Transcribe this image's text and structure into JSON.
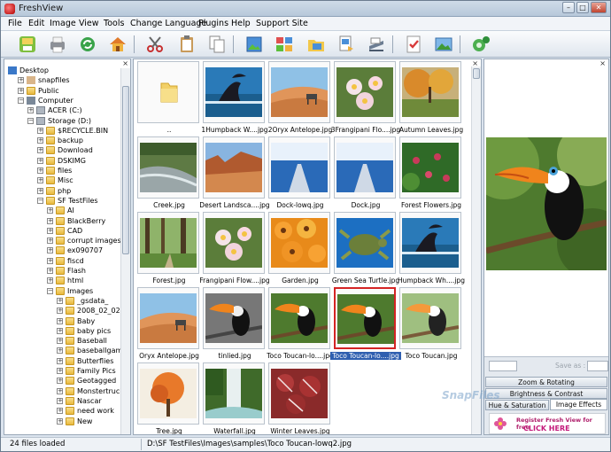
{
  "window": {
    "title": "FreshView"
  },
  "menu": [
    "File",
    "Edit",
    "Image",
    "View",
    "Tools",
    "Change Language",
    "Plugins",
    "Help",
    "Support Site"
  ],
  "tree": {
    "rows": [
      {
        "label": "Desktop",
        "depth": 0,
        "exp": "",
        "icon": "desktop"
      },
      {
        "label": "snapfiles",
        "depth": 1,
        "exp": "+",
        "icon": "user"
      },
      {
        "label": "Public",
        "depth": 1,
        "exp": "+",
        "icon": "folder"
      },
      {
        "label": "Computer",
        "depth": 1,
        "exp": "-",
        "icon": "computer"
      },
      {
        "label": "ACER (C:)",
        "depth": 2,
        "exp": "+",
        "icon": "drive"
      },
      {
        "label": "Storage (D:)",
        "depth": 2,
        "exp": "-",
        "icon": "drive"
      },
      {
        "label": "$RECYCLE.BIN",
        "depth": 3,
        "exp": "+",
        "icon": "folder"
      },
      {
        "label": "backup",
        "depth": 3,
        "exp": "+",
        "icon": "folder"
      },
      {
        "label": "Download",
        "depth": 3,
        "exp": "+",
        "icon": "folder"
      },
      {
        "label": "DSKIMG",
        "depth": 3,
        "exp": "+",
        "icon": "folder"
      },
      {
        "label": "files",
        "depth": 3,
        "exp": "+",
        "icon": "folder"
      },
      {
        "label": "Misc",
        "depth": 3,
        "exp": "+",
        "icon": "folder"
      },
      {
        "label": "php",
        "depth": 3,
        "exp": "+",
        "icon": "folder"
      },
      {
        "label": "SF TestFiles",
        "depth": 3,
        "exp": "-",
        "icon": "folder"
      },
      {
        "label": "AI",
        "depth": 4,
        "exp": "+",
        "icon": "folder"
      },
      {
        "label": "BlackBerry",
        "depth": 4,
        "exp": "+",
        "icon": "folder"
      },
      {
        "label": "CAD",
        "depth": 4,
        "exp": "+",
        "icon": "folder"
      },
      {
        "label": "corrupt images",
        "depth": 4,
        "exp": "+",
        "icon": "folder"
      },
      {
        "label": "ex090707",
        "depth": 4,
        "exp": "+",
        "icon": "folder"
      },
      {
        "label": "fiscd",
        "depth": 4,
        "exp": "+",
        "icon": "folder"
      },
      {
        "label": "Flash",
        "depth": 4,
        "exp": "+",
        "icon": "folder"
      },
      {
        "label": "html",
        "depth": 4,
        "exp": "+",
        "icon": "folder"
      },
      {
        "label": "Images",
        "depth": 4,
        "exp": "-",
        "icon": "folder"
      },
      {
        "label": "_gsdata_",
        "depth": 5,
        "exp": "+",
        "icon": "folder"
      },
      {
        "label": "2008_02_02",
        "depth": 5,
        "exp": "+",
        "icon": "folder"
      },
      {
        "label": "Baby",
        "depth": 5,
        "exp": "+",
        "icon": "folder"
      },
      {
        "label": "baby pics",
        "depth": 5,
        "exp": "+",
        "icon": "folder"
      },
      {
        "label": "Baseball",
        "depth": 5,
        "exp": "+",
        "icon": "folder"
      },
      {
        "label": "baseballgame",
        "depth": 5,
        "exp": "+",
        "icon": "folder"
      },
      {
        "label": "Butterflies",
        "depth": 5,
        "exp": "+",
        "icon": "folder"
      },
      {
        "label": "Family Pics",
        "depth": 5,
        "exp": "+",
        "icon": "folder"
      },
      {
        "label": "Geotagged",
        "depth": 5,
        "exp": "+",
        "icon": "folder"
      },
      {
        "label": "Monstertruck",
        "depth": 5,
        "exp": "+",
        "icon": "folder"
      },
      {
        "label": "Nascar",
        "depth": 5,
        "exp": "+",
        "icon": "folder"
      },
      {
        "label": "need work",
        "depth": 5,
        "exp": "+",
        "icon": "folder"
      },
      {
        "label": "New",
        "depth": 5,
        "exp": "+",
        "icon": "folder"
      }
    ]
  },
  "thumbnails": [
    {
      "caption": "..",
      "kind": "folder"
    },
    {
      "caption": "1Humpback W....jpg",
      "kind": "whale"
    },
    {
      "caption": "2Oryx Antelope.jpg",
      "kind": "desert"
    },
    {
      "caption": "3Frangipani Flo....jpg",
      "kind": "flower"
    },
    {
      "caption": "Autumn Leaves.jpg",
      "kind": "autumn"
    },
    {
      "caption": "Creek.jpg",
      "kind": "creek"
    },
    {
      "caption": "Desert Landsca....jpg",
      "kind": "canyon"
    },
    {
      "caption": "Dock-lowq.jpg",
      "kind": "dock"
    },
    {
      "caption": "Dock.jpg",
      "kind": "dock"
    },
    {
      "caption": "Forest Flowers.jpg",
      "kind": "forest-flowers"
    },
    {
      "caption": "Forest.jpg",
      "kind": "forest"
    },
    {
      "caption": "Frangipani Flow....jpg",
      "kind": "flower"
    },
    {
      "caption": "Garden.jpg",
      "kind": "garden"
    },
    {
      "caption": "Green Sea Turtle.jpg",
      "kind": "turtle"
    },
    {
      "caption": "Humpback Wh....jpg",
      "kind": "whale"
    },
    {
      "caption": "Oryx Antelope.jpg",
      "kind": "desert"
    },
    {
      "caption": "tinlied.jpg",
      "kind": "toucan-gray"
    },
    {
      "caption": "Toco Toucan-lo....jpg",
      "kind": "toucan"
    },
    {
      "caption": "Toco Toucan-lo....jpg",
      "kind": "toucan",
      "selected": true
    },
    {
      "caption": "Toco Toucan.jpg",
      "kind": "toucan-light"
    },
    {
      "caption": "Tree.jpg",
      "kind": "tree"
    },
    {
      "caption": "Waterfall.jpg",
      "kind": "waterfall"
    },
    {
      "caption": "Winter Leaves.jpg",
      "kind": "winter"
    }
  ],
  "preview": {
    "save_as_label": "Save as :",
    "buttons": {
      "zoom": "Zoom & Rotating",
      "brightness": "Brightness & Contrast",
      "hue": "Hue & Saturation",
      "effects": "Image Effects"
    },
    "ad_line1": "Register Fresh View for free",
    "ad_line2": "CLICK HERE"
  },
  "watermark": "SnapFiles",
  "status": {
    "count": "24 files loaded",
    "path": "D:\\SF TestFiles\\Images\\samples\\Toco Toucan-lowq2.jpg"
  }
}
